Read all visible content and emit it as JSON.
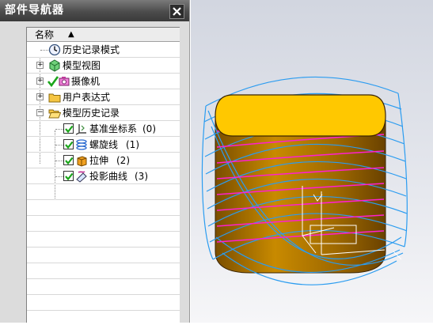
{
  "window": {
    "title": "部件导航器"
  },
  "tree": {
    "column_header": "名称",
    "items": [
      {
        "label": "历史记录模式",
        "icon": "clock-icon"
      },
      {
        "label": "模型视图",
        "icon": "model-view-icon"
      },
      {
        "label": "摄像机",
        "icon": "camera-icon"
      },
      {
        "label": "用户表达式",
        "icon": "folder-icon"
      },
      {
        "label": "模型历史记录",
        "icon": "folder-open-icon"
      },
      {
        "label": "基准坐标系",
        "suffix": "(0)",
        "icon": "datum-csys-icon"
      },
      {
        "label": "螺旋线",
        "suffix": "(1)",
        "icon": "helix-icon"
      },
      {
        "label": "拉伸",
        "suffix": "(2)",
        "icon": "extrude-icon"
      },
      {
        "label": "投影曲线",
        "suffix": "(3)",
        "icon": "projected-curve-icon"
      }
    ]
  },
  "colors": {
    "body_top": "#ffc800",
    "body_side": "#c88a00",
    "helix": "#2b9cf0",
    "projected_curve": "#ff20d0"
  }
}
